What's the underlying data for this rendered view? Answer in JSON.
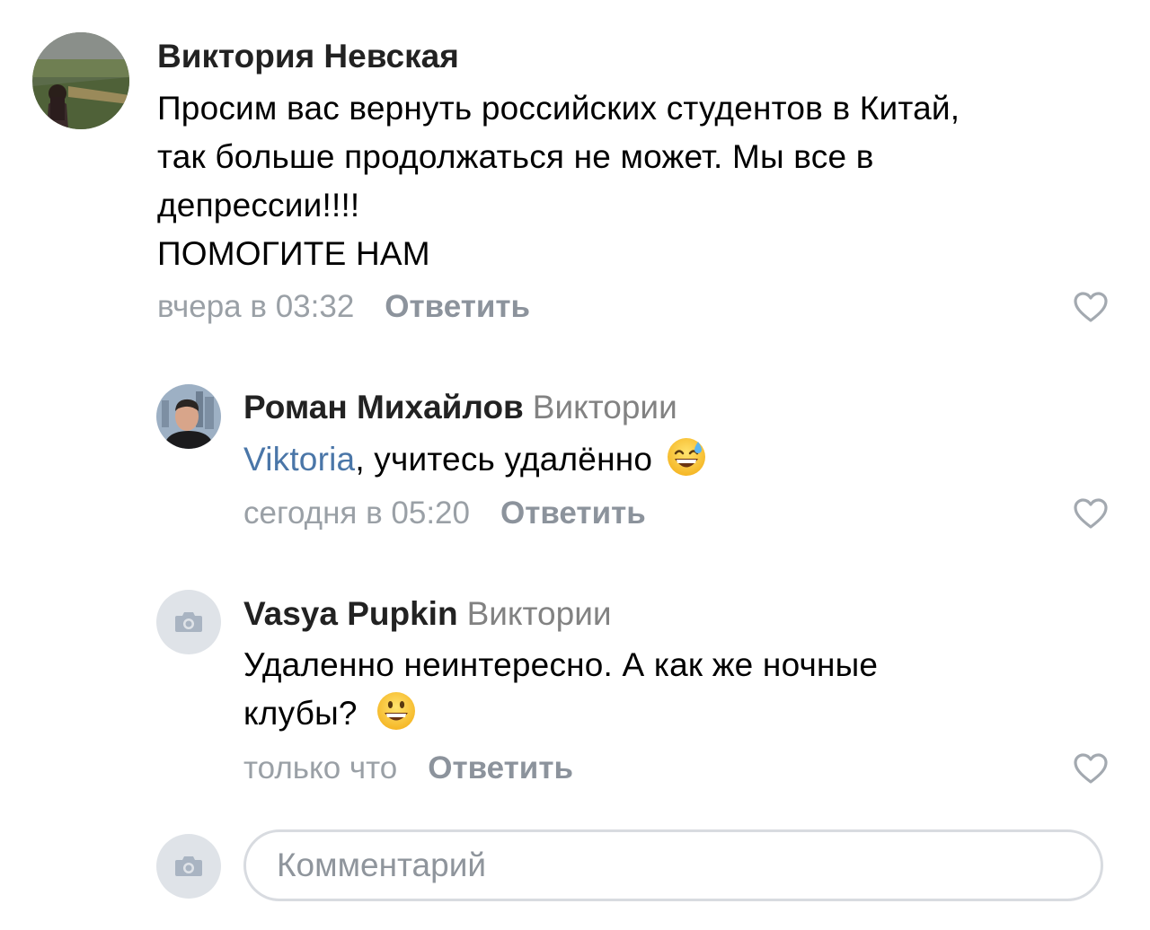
{
  "comments": [
    {
      "author": "Виктория Невская",
      "text_lines": [
        "Просим вас вернуть российских студентов в Китай,",
        "так больше продолжаться не может. Мы все в",
        "депрессии!!!!",
        "ПОМОГИТЕ НАМ"
      ],
      "time": "вчера в 03:32",
      "reply_label": "Ответить"
    },
    {
      "author": "Роман Михайлов",
      "reply_to": "Виктории",
      "mention": "Viktoria",
      "text": ", учитесь удалённо",
      "emoji": "sweat-smile",
      "time": "сегодня в 05:20",
      "reply_label": "Ответить"
    },
    {
      "author": "Vasya Pupkin",
      "reply_to": "Виктории",
      "text_lines": [
        "Удаленно неинтересно. А как же ночные",
        "клубы?"
      ],
      "emoji": "grinning",
      "time": "только что",
      "reply_label": "Ответить"
    }
  ],
  "composer": {
    "placeholder": "Комментарий"
  },
  "icons": {
    "like": "heart-outline-icon",
    "no_photo": "camera-icon"
  },
  "colors": {
    "mention": "#4a76a8",
    "meta": "#9aa0a6",
    "avatar_placeholder": "#dfe3e8"
  }
}
